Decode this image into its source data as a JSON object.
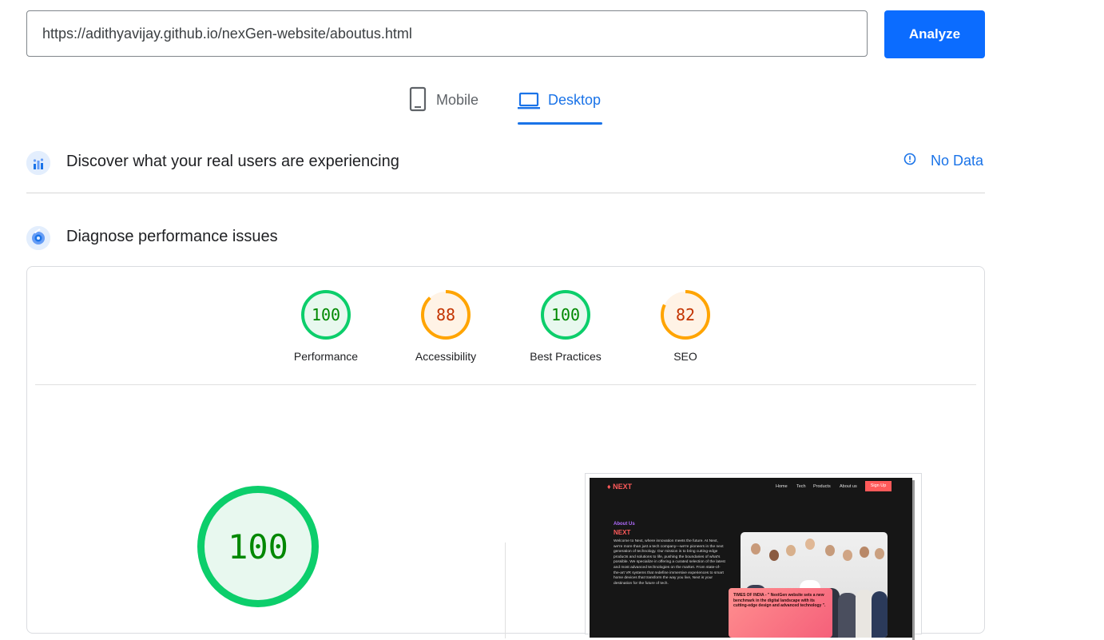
{
  "search": {
    "url": "https://adithyavijay.github.io/nexGen-website/aboutus.html",
    "analyze_label": "Analyze"
  },
  "tabs": [
    {
      "label": "Mobile",
      "icon": "phone-icon",
      "selected": false
    },
    {
      "label": "Desktop",
      "icon": "laptop-icon",
      "selected": true
    }
  ],
  "field_data": {
    "title": "Discover what your real users are experiencing",
    "status": "No Data",
    "icon": "crux-icon"
  },
  "lab": {
    "title": "Diagnose performance issues",
    "icon": "lighthouse-icon",
    "scores": [
      {
        "label": "Performance",
        "value": "100",
        "color": "#0cce6b",
        "text_color": "#008800",
        "bg": "#e8f8ef",
        "fraction": 1.0
      },
      {
        "label": "Accessibility",
        "value": "88",
        "color": "#ffa400",
        "text_color": "#c33300",
        "bg": "#fff3e6",
        "fraction": 0.88
      },
      {
        "label": "Best Practices",
        "value": "100",
        "color": "#0cce6b",
        "text_color": "#008800",
        "bg": "#e8f8ef",
        "fraction": 1.0
      },
      {
        "label": "SEO",
        "value": "82",
        "color": "#ffa400",
        "text_color": "#c33300",
        "bg": "#fff3e6",
        "fraction": 0.82
      }
    ],
    "big_score": {
      "value": "100",
      "fraction": 1.0,
      "color": "#0cce6b",
      "text_color": "#008800"
    }
  },
  "screenshot": {
    "logo": "NEXT",
    "nav": [
      "Home",
      "Tech",
      "Products",
      "About us"
    ],
    "signup": "Sign Up",
    "about_heading": "About Us",
    "brand": "NEXT",
    "body": "Welcome to Next, where innovation meets the future. At Next, we're more than just a tech company—we're pioneers in the next generation of technology. Our mission is to bring cutting-edge products and solutions to life, pushing the boundaries of what's possible. We specialize in offering a curated selection of the latest and most advanced technologies on the market. From state-of-the-art VR systems that redefine immersive experiences to smart home devices that transform the way you live, Next is your destination for the future of tech.",
    "quote": "TIMES OF INDIA - \" NextGen website sets a new benchmark in the digital landscape with its cutting-edge design and advanced technology \"."
  }
}
